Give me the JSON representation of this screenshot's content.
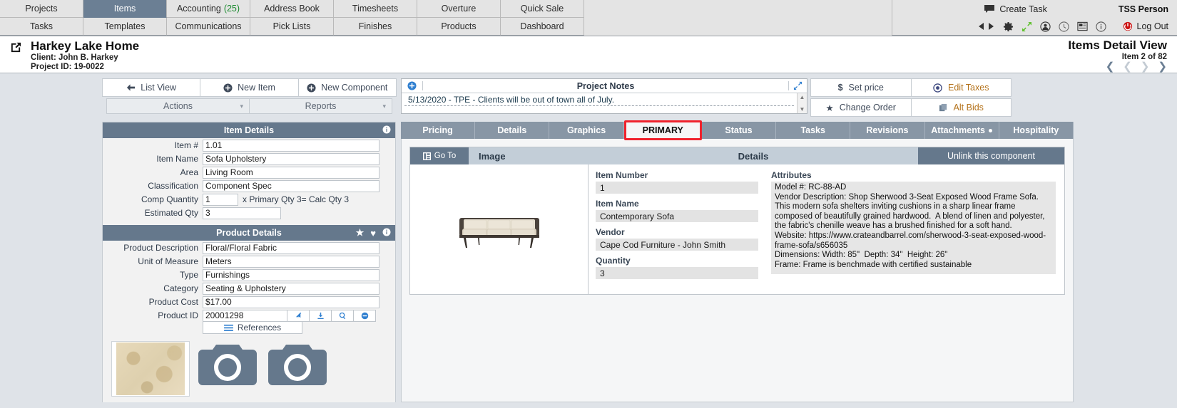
{
  "nav": {
    "row1": [
      {
        "label": "Projects",
        "active": false
      },
      {
        "label": "Items",
        "active": true
      },
      {
        "label": "Accounting",
        "badge": "(25)",
        "active": false
      },
      {
        "label": "Address Book",
        "active": false
      },
      {
        "label": "Timesheets",
        "active": false
      },
      {
        "label": "Overture",
        "active": false
      },
      {
        "label": "Quick Sale",
        "active": false
      }
    ],
    "row2": [
      {
        "label": "Tasks",
        "active": false
      },
      {
        "label": "Templates",
        "active": false
      },
      {
        "label": "Communications",
        "active": false
      },
      {
        "label": "Pick Lists",
        "active": false
      },
      {
        "label": "Finishes",
        "active": false
      },
      {
        "label": "Products",
        "active": false
      },
      {
        "label": "Dashboard",
        "active": false
      }
    ],
    "create_task": "Create Task",
    "user": "TSS Person",
    "logout": "Log Out"
  },
  "header": {
    "project_title": "Harkey Lake Home",
    "client": "Client: John B. Harkey",
    "project_id": "Project ID: 19-0022",
    "view_title": "Items Detail View",
    "item_of": "Item 2 of 82"
  },
  "toolbar": {
    "list_view": "List View",
    "new_item": "New Item",
    "new_component": "New Component",
    "actions": "Actions",
    "reports": "Reports"
  },
  "notes": {
    "title": "Project Notes",
    "text": "5/13/2020 - TPE - Clients will be out of town all of July."
  },
  "actions": {
    "set_price": "Set price",
    "edit_taxes": "Edit Taxes",
    "change_order": "Change Order",
    "alt_bids": "Alt Bids"
  },
  "item_details": {
    "title": "Item Details",
    "fields": [
      {
        "label": "Item #",
        "value": "1.01"
      },
      {
        "label": "Item Name",
        "value": "Sofa Upholstery"
      },
      {
        "label": "Area",
        "value": "Living Room"
      },
      {
        "label": "Classification",
        "value": "Component Spec"
      }
    ],
    "comp_quantity_label": "Comp Quantity",
    "comp_quantity_value": "1",
    "comp_quantity_suffix": "x Primary Qty 3= Calc Qty 3",
    "estimated_qty_label": "Estimated Qty",
    "estimated_qty_value": "3"
  },
  "product_details": {
    "title": "Product Details",
    "fields": [
      {
        "label": "Product Description",
        "value": "Floral/Floral Fabric"
      },
      {
        "label": "Unit of Measure",
        "value": "Meters"
      },
      {
        "label": "Type",
        "value": "Furnishings"
      },
      {
        "label": "Category",
        "value": "Seating & Upholstery"
      },
      {
        "label": "Product Cost",
        "value": "$17.00"
      }
    ],
    "product_id_label": "Product ID",
    "product_id_value": "20001298",
    "references": "References"
  },
  "tabs": [
    {
      "label": "Pricing",
      "active": false,
      "dot": false
    },
    {
      "label": "Details",
      "active": false,
      "dot": false
    },
    {
      "label": "Graphics",
      "active": false,
      "dot": false
    },
    {
      "label": "PRIMARY",
      "active": true,
      "dot": false
    },
    {
      "label": "Status",
      "active": false,
      "dot": false
    },
    {
      "label": "Tasks",
      "active": false,
      "dot": false
    },
    {
      "label": "Revisions",
      "active": false,
      "dot": false
    },
    {
      "label": "Attachments",
      "active": false,
      "dot": true
    },
    {
      "label": "Hospitality",
      "active": false,
      "dot": false
    }
  ],
  "primary": {
    "goto": "Go To",
    "image_header": "Image",
    "details_header": "Details",
    "unlink": "Unlink this component",
    "item_number_label": "Item Number",
    "item_number_value": "1",
    "item_name_label": "Item Name",
    "item_name_value": "Contemporary Sofa",
    "vendor_label": "Vendor",
    "vendor_value": "Cape Cod Furniture - John Smith",
    "quantity_label": "Quantity",
    "quantity_value": "3",
    "attributes_label": "Attributes",
    "attributes_text": "Model #: RC-88-AD\nVendor Description: Shop Sherwood 3-Seat Exposed Wood Frame Sofa.  This modern sofa shelters inviting cushions in a sharp linear frame composed of beautifully grained hardwood.  A blend of linen and polyester, the fabric's chenille weave has a brushed finished for a soft hand.\nWebsite: https://www.crateandbarrel.com/sherwood-3-seat-exposed-wood-frame-sofa/s656035\nDimensions: Width: 85\"  Depth: 34\"  Height: 26\"\nFrame: Frame is benchmade with certified sustainable"
  },
  "colors": {
    "nav_active": "#6b7f94",
    "panel_header": "#65788c",
    "tab_bar": "#8896a5",
    "active_tab_outline": "#f0222c",
    "badge_green": "#1a8a2e",
    "logout_red": "#cc1111"
  }
}
